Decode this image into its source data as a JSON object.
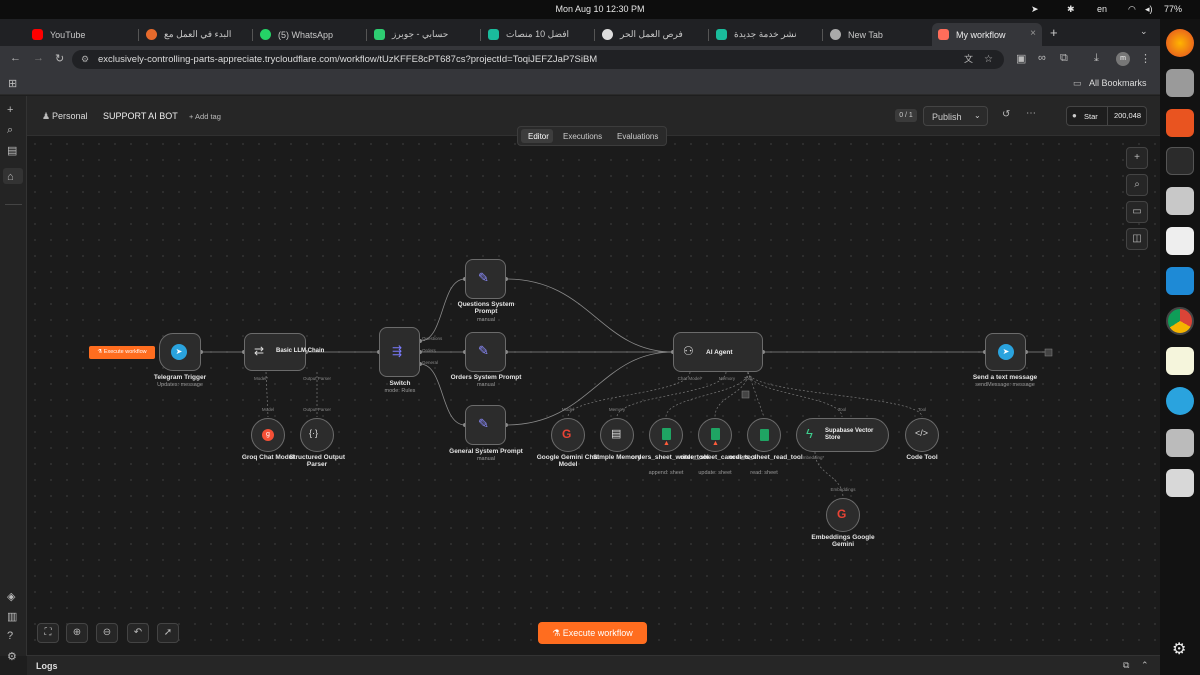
{
  "os": {
    "clock": "Mon Aug 10  12:30 PM",
    "lang": "en",
    "battery": "77%"
  },
  "tabs": [
    {
      "label": "YouTube",
      "color": "#ff0000"
    },
    {
      "label": "البدء في العمل مع",
      "color": "#e66a2c"
    },
    {
      "label": "(5) WhatsApp",
      "color": "#25d366"
    },
    {
      "label": "حسابي - جوبرز",
      "color": "#2ecc71"
    },
    {
      "label": "افضل 10 منصات",
      "color": "#1abc9c"
    },
    {
      "label": "فرص العمل الحر",
      "color": "#dddddd"
    },
    {
      "label": "نشر خدمة جديدة",
      "color": "#1abc9c"
    },
    {
      "label": "New Tab",
      "color": "#aaaaaa"
    },
    {
      "label": "My workflow",
      "color": "#ff6d5a"
    }
  ],
  "url": "exclusively-controlling-parts-appreciate.trycloudflare.com/workflow/tUzKFFE8cPT687cs?projectId=ToqiJEFZJaP7SiBM",
  "bookmarks": "All Bookmarks",
  "header": {
    "project": "Personal",
    "name": "SUPPORT AI BOT",
    "add_tag": "+ Add tag",
    "counter": "0 / 1",
    "publish": "Publish",
    "star": "Star",
    "stars": "200,048"
  },
  "view_tabs": [
    "Editor",
    "Executions",
    "Evaluations"
  ],
  "execute_small": "Execute workflow",
  "execute_main": "Execute workflow",
  "logs": "Logs",
  "nodes": {
    "telegram": {
      "label": "Telegram Trigger",
      "sub": "Updates: message"
    },
    "llm": {
      "label": "Basic LLM Chain",
      "p1": "Model*",
      "p2": "Output Parser"
    },
    "groq": {
      "label": "Groq Chat Model",
      "port": "Model"
    },
    "structured": {
      "label": "Structured Output Parser",
      "port": "Output Parser"
    },
    "switch": {
      "label": "Switch",
      "sub": "mode: Rules",
      "o1": "Questions",
      "o2": "Orders",
      "o3": "General"
    },
    "q_prompt": {
      "label": "Questions System Prompt",
      "sub": "manual"
    },
    "o_prompt": {
      "label": "Orders System Prompt",
      "sub": "manual"
    },
    "g_prompt": {
      "label": "General System Prompt",
      "sub": "manual"
    },
    "agent": {
      "label": "AI Agent",
      "p1": "Chat Model*",
      "p2": "Memory",
      "p3": "Tool"
    },
    "gemini": {
      "label": "Google Gemini Chat Model",
      "port": "Model"
    },
    "memory": {
      "label": "Simple Memory",
      "port": "Memory"
    },
    "writer": {
      "label": "orders_sheet_writer_tool",
      "sub": "append: sheet"
    },
    "cancel": {
      "label": "order_sheet_cancel_tool",
      "sub": "update: sheet"
    },
    "reader": {
      "label": "orders_sheet_read_tool",
      "sub": "read: sheet"
    },
    "supabase": {
      "label": "Supabase Vector Store",
      "port": "Tool",
      "p1": "Embedding*"
    },
    "code": {
      "label": "Code Tool",
      "port": "Tool"
    },
    "embed": {
      "label": "Embeddings Google Gemini",
      "port": "Embeddings"
    },
    "send": {
      "label": "Send a text message",
      "sub": "sendMessage: message"
    }
  }
}
